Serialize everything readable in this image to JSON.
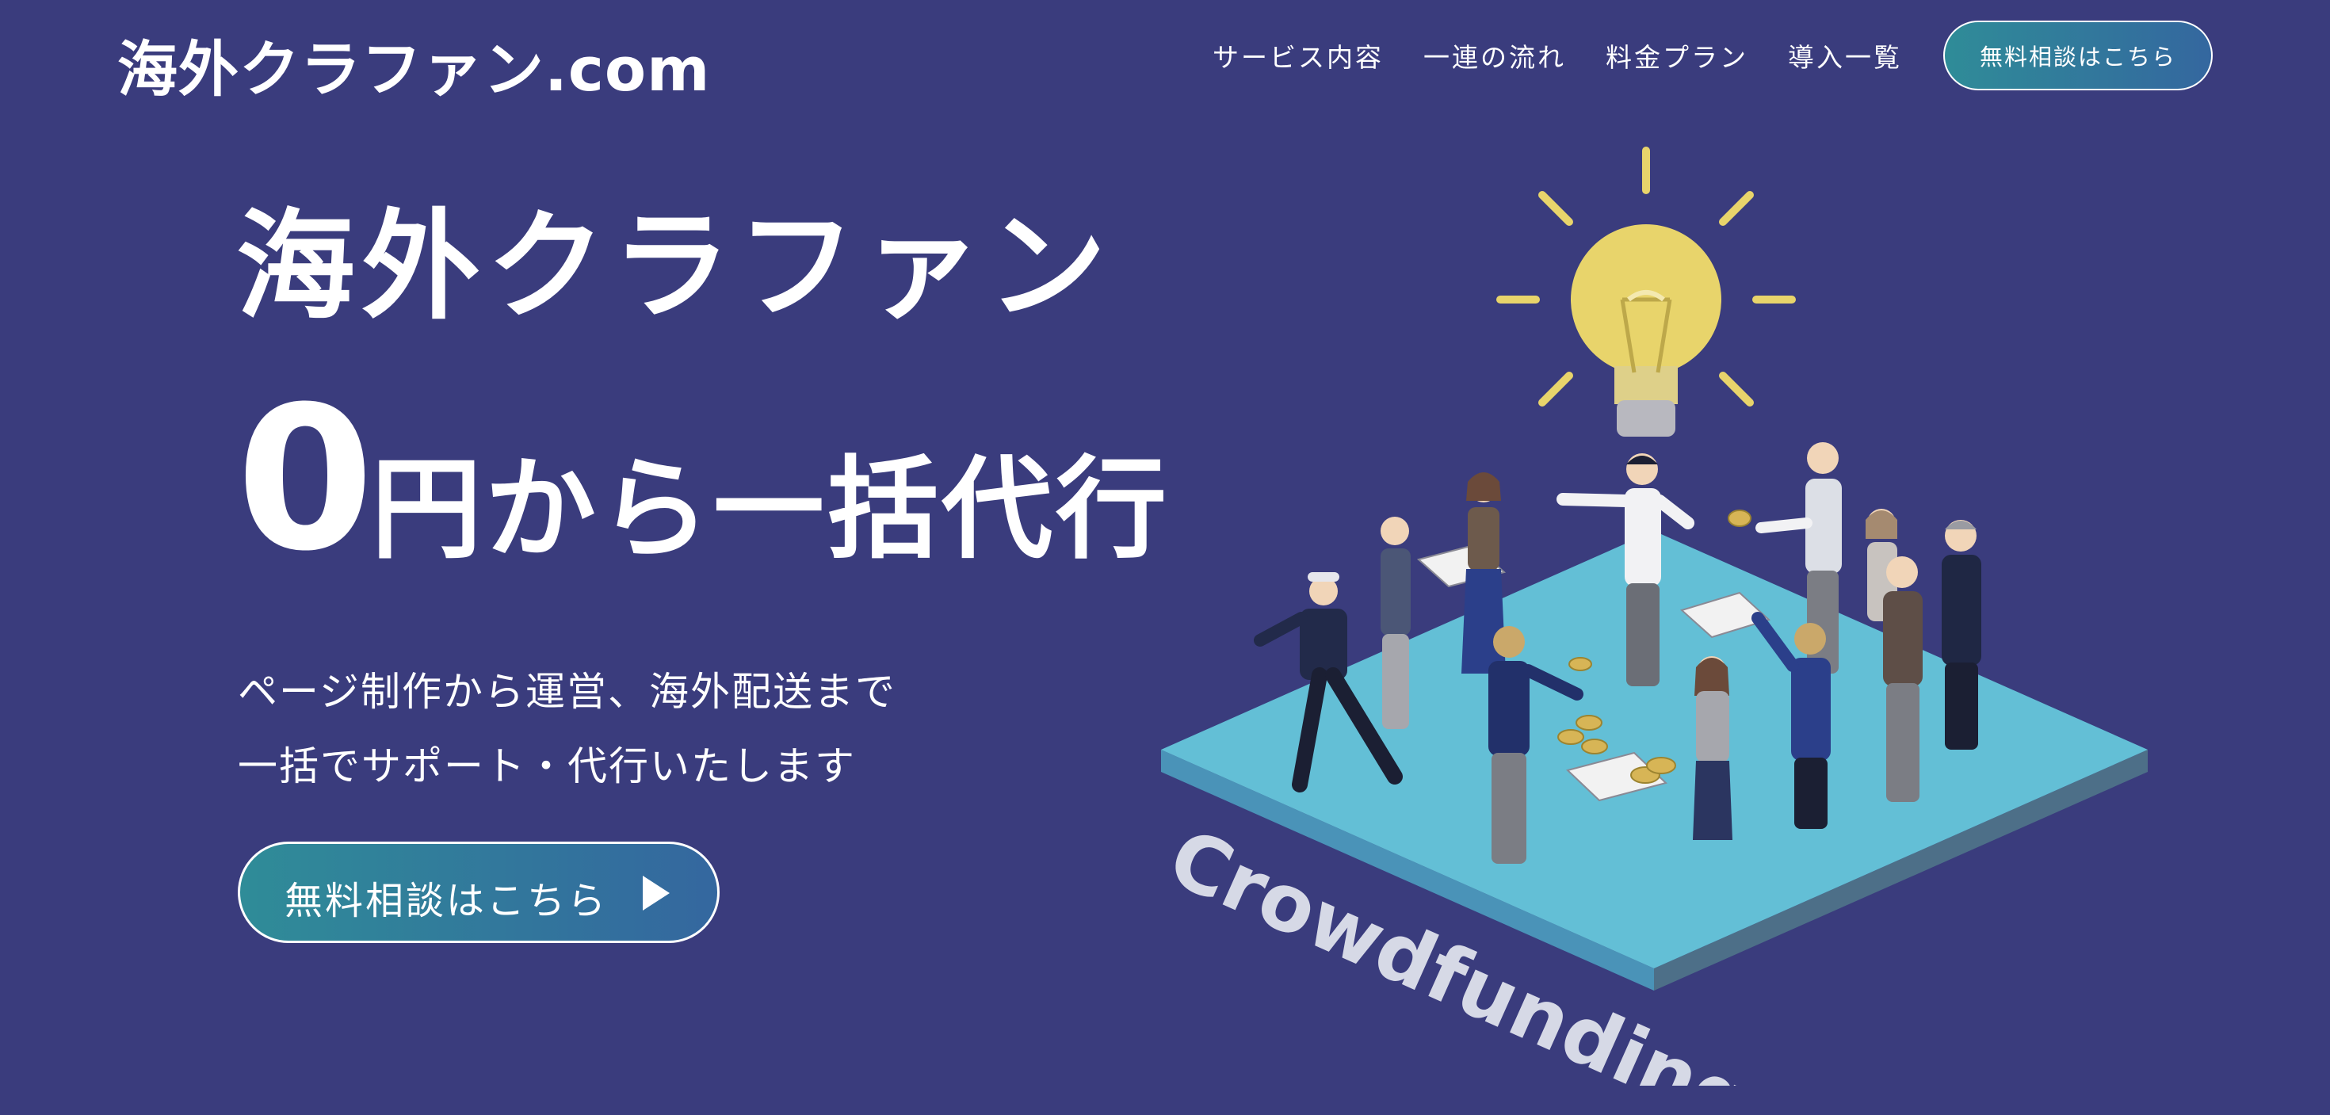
{
  "header": {
    "logo": "海外クラファン.com",
    "nav": [
      "サービス内容",
      "一連の流れ",
      "料金プラン",
      "導入一覧"
    ],
    "cta_label": "無料相談はこちら"
  },
  "hero": {
    "title_line1": "海外クラファン",
    "title_number": "0",
    "title_rest": "円から一括代行",
    "sub_line1": "ページ制作から運営、海外配送まで",
    "sub_line2": "一括でサポート・代行いたします",
    "cta_label": "無料相談はこちら"
  },
  "illustration": {
    "platform_text": "Crowdfunding",
    "colors": {
      "background": "#3a3c7d",
      "platform_top": "#63bfd6",
      "platform_side_left": "#4a93b8",
      "platform_side_right": "#4d6f88",
      "bulb": "#e8d46b",
      "cta_gradient_start": "#2f8c98",
      "cta_gradient_end": "#34679f"
    }
  }
}
